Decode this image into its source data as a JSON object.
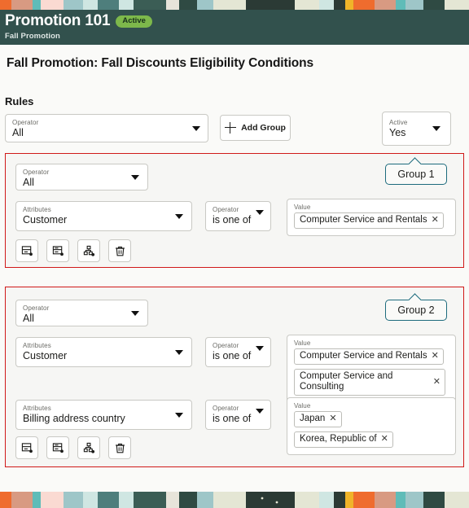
{
  "header": {
    "title": "Promotion 101",
    "status_badge": "Active",
    "subtitle": "Fall Promotion",
    "bg_color": "#32514d",
    "badge_color": "#7db84b"
  },
  "page": {
    "heading": "Fall Promotion: Fall Discounts Eligibility Conditions",
    "section_label": "Rules",
    "group_border_color": "#d01919",
    "group_tag_color": "#1d6b7d"
  },
  "toolbar": {
    "operator": {
      "label": "Operator",
      "value": "All"
    },
    "add_group_label": "Add Group",
    "active": {
      "label": "Active",
      "value": "Yes"
    }
  },
  "icon_buttons": [
    {
      "name": "add-condition",
      "icon": "add-row-icon"
    },
    {
      "name": "add-nested-condition",
      "icon": "add-nested-row-icon"
    },
    {
      "name": "add-subgroup",
      "icon": "add-group-node-icon"
    },
    {
      "name": "delete-group",
      "icon": "trash-icon"
    }
  ],
  "groups": [
    {
      "tag": "Group 1",
      "operator": {
        "label": "Operator",
        "value": "All"
      },
      "rows": [
        {
          "attribute": {
            "label": "Attributes",
            "value": "Customer"
          },
          "operator": {
            "label": "Operator",
            "value": "is one of"
          },
          "value": {
            "label": "Value",
            "chips": [
              "Computer Service and Rentals"
            ]
          }
        }
      ]
    },
    {
      "tag": "Group 2",
      "operator": {
        "label": "Operator",
        "value": "All"
      },
      "rows": [
        {
          "attribute": {
            "label": "Attributes",
            "value": "Customer"
          },
          "operator": {
            "label": "Operator",
            "value": "is one of"
          },
          "value": {
            "label": "Value",
            "chips": [
              "Computer Service and Rentals",
              "Computer Service and Consulting"
            ]
          }
        },
        {
          "attribute": {
            "label": "Attributes",
            "value": "Billing address country"
          },
          "operator": {
            "label": "Operator",
            "value": "is one of"
          },
          "value": {
            "label": "Value",
            "chips": [
              "Japan",
              "Korea, Republic of"
            ]
          }
        }
      ]
    }
  ]
}
